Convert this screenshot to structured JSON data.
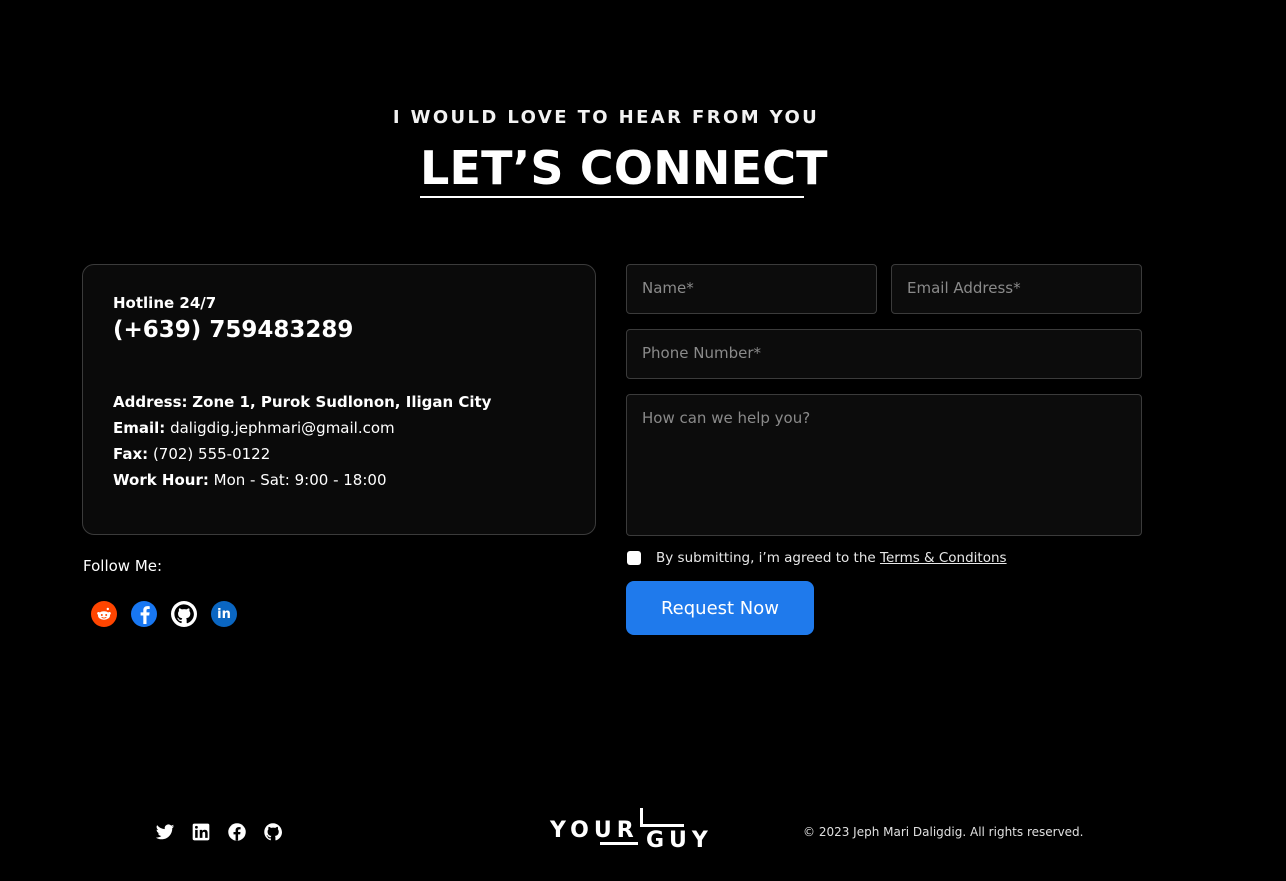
{
  "header": {
    "eyebrow": "I WOULD LOVE TO HEAR FROM YOU",
    "title": "LET’S CONNECT"
  },
  "contact": {
    "hotline_label": "Hotline 24/7",
    "hotline_number": "(+639) 759483289",
    "address_label": "Address:",
    "address_value": "Zone 1, Purok Sudlonon, Iligan City",
    "email_label": "Email:",
    "email_value": "daligdig.jephmari@gmail.com",
    "fax_label": "Fax:",
    "fax_value": "(702) 555-0122",
    "hours_label": "Work Hour:",
    "hours_value": "Mon - Sat: 9:00 - 18:00"
  },
  "follow": {
    "label": "Follow Me:",
    "icons": [
      "reddit-icon",
      "facebook-icon",
      "github-icon",
      "linkedin-icon"
    ],
    "colors": {
      "reddit": "#ff4500",
      "facebook": "#1877f2",
      "github": "#ffffff",
      "linkedin": "#0a66c2"
    }
  },
  "form": {
    "name_placeholder": "Name*",
    "email_placeholder": "Email Address*",
    "phone_placeholder": "Phone Number*",
    "message_placeholder": "How can we help you?",
    "agree_text": "By submitting, i’m agreed to the",
    "terms_link": "Terms & Conditons",
    "submit_label": "Request Now",
    "accent": "#1f7aec"
  },
  "footer": {
    "icons": [
      "twitter-icon",
      "linkedin-icon",
      "facebook-icon",
      "github-icon"
    ],
    "logo_text_top": "YOUR",
    "logo_text_bottom": "GUY",
    "copyright": "© 2023 Jeph Mari Daligdig. All rights reserved."
  }
}
